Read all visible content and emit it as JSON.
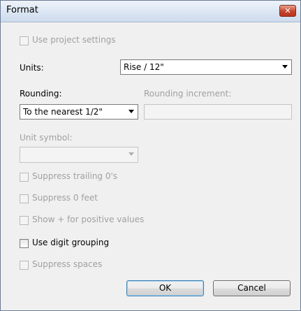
{
  "window": {
    "title": "Format",
    "close_icon": "close-icon"
  },
  "checkboxes": {
    "use_project_settings": {
      "label": "Use project settings",
      "checked": false,
      "enabled": false
    },
    "suppress_trailing_zeros": {
      "label": "Suppress trailing 0's",
      "checked": false,
      "enabled": false
    },
    "suppress_zero_feet": {
      "label": "Suppress 0 feet",
      "checked": false,
      "enabled": false
    },
    "show_plus": {
      "label": "Show + for positive values",
      "checked": false,
      "enabled": false
    },
    "use_digit_grouping": {
      "label": "Use digit grouping",
      "checked": false,
      "enabled": true
    },
    "suppress_spaces": {
      "label": "Suppress spaces",
      "checked": false,
      "enabled": false
    }
  },
  "units": {
    "label": "Units:",
    "value": "Rise / 12\""
  },
  "rounding": {
    "label": "Rounding:",
    "value": "To the nearest 1/2\""
  },
  "rounding_increment": {
    "label": "Rounding increment:",
    "value": ""
  },
  "unit_symbol": {
    "label": "Unit symbol:",
    "value": ""
  },
  "buttons": {
    "ok": "OK",
    "cancel": "Cancel"
  }
}
